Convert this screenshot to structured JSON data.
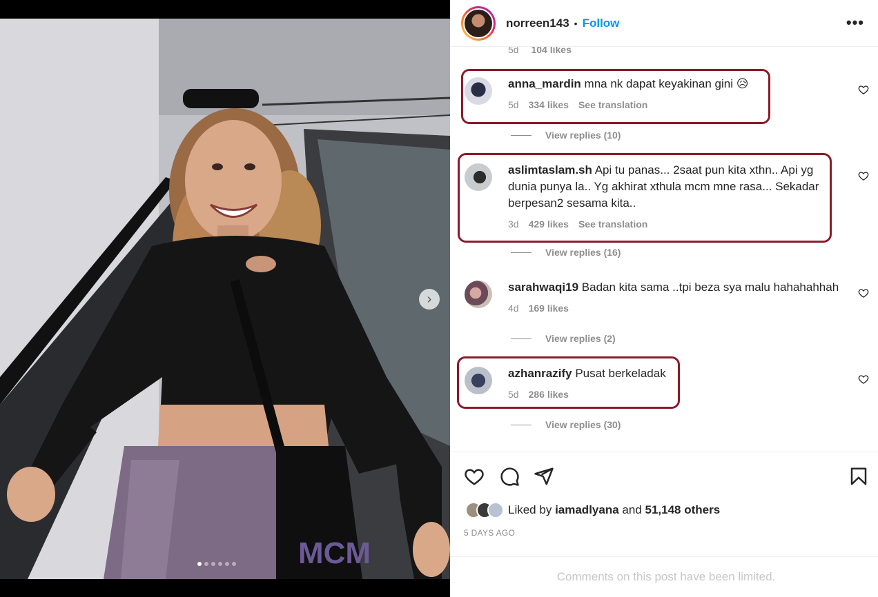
{
  "post": {
    "username": "norreen143",
    "follow_label": "Follow",
    "separator": "•",
    "more_label": "•••",
    "carousel": {
      "slide_count": 6,
      "active_slide": 1,
      "next_label": "›"
    }
  },
  "partial_comment": {
    "age": "5d",
    "likes": "104 likes"
  },
  "comments": [
    {
      "user": "anna_mardin",
      "text": "mna nk dapat keyakinan gini 😥",
      "age": "5d",
      "likes": "334 likes",
      "translate": "See translation",
      "replies": "View replies (10)",
      "highlighted": true
    },
    {
      "user": "aslimtaslam.sh",
      "text": "Api tu panas... 2saat pun kita xthn.. Api yg dunia punya la.. Yg akhirat xthula mcm mne rasa... Sekadar berpesan2 sesama kita..",
      "age": "3d",
      "likes": "429 likes",
      "translate": "See translation",
      "replies": "View replies (16)",
      "highlighted": true
    },
    {
      "user": "sarahwaqi19",
      "text": "Badan kita sama ..tpi beza sya malu hahahahhah",
      "age": "4d",
      "likes": "169 likes",
      "translate": "",
      "replies": "View replies (2)",
      "highlighted": false
    },
    {
      "user": "azhanrazify",
      "text": "Pusat berkeladak",
      "age": "5d",
      "likes": "286 likes",
      "translate": "",
      "replies": "View replies (30)",
      "highlighted": true
    }
  ],
  "likes_summary": {
    "prefix": "Liked by",
    "user": "iamadlyana",
    "and": "and",
    "others": "51,148 others"
  },
  "timestamp": "5 DAYS AGO",
  "limited_notice": "Comments on this post have been limited.",
  "icons": [
    "heart-icon",
    "comment-icon",
    "share-icon",
    "bookmark-icon",
    "more-icon",
    "chevron-right-icon"
  ],
  "colors": {
    "follow": "#0095f6",
    "highlight": "#8b1a2b",
    "muted": "#8e8e8e"
  }
}
